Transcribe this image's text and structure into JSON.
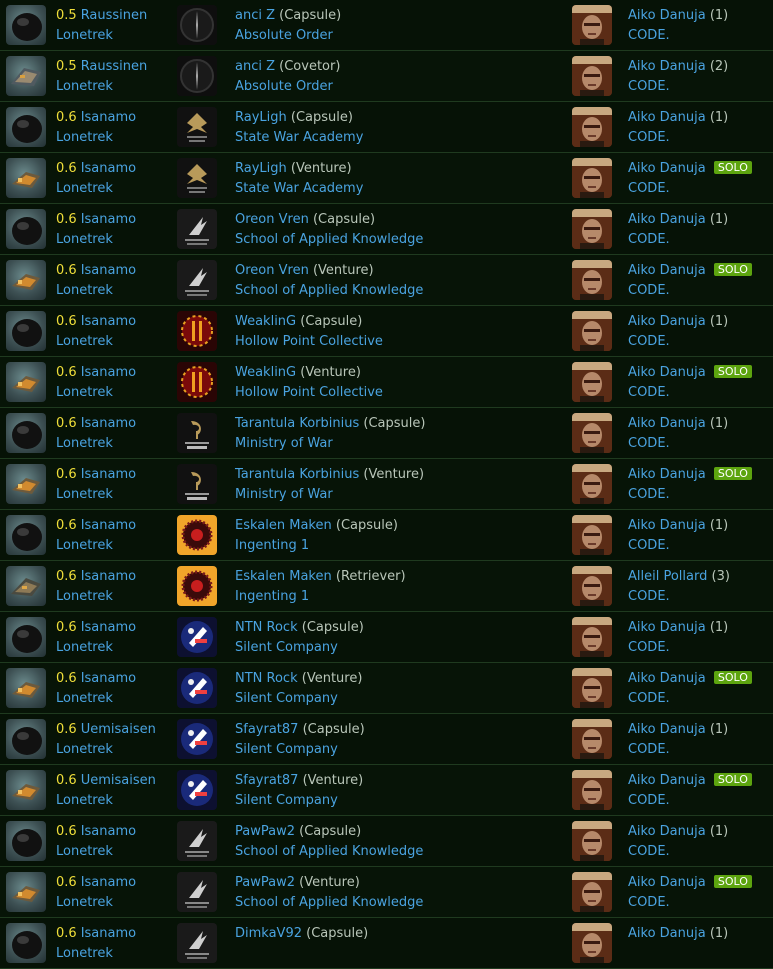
{
  "kills": [
    {
      "ship_icon": "capsule-icon",
      "sec": "0.5",
      "system": "Raussinen",
      "region": "Lonetrek",
      "corp_logo": "absolute-order-logo",
      "victim_name": "anci Z",
      "victim_ship": "(Capsule)",
      "victim_corp": "Absolute Order",
      "attacker": "Aiko Danuja",
      "count": "(1)",
      "solo": "",
      "attacker_corp": "CODE."
    },
    {
      "ship_icon": "covetor-icon",
      "sec": "0.5",
      "system": "Raussinen",
      "region": "Lonetrek",
      "corp_logo": "absolute-order-logo",
      "victim_name": "anci Z",
      "victim_ship": "(Covetor)",
      "victim_corp": "Absolute Order",
      "attacker": "Aiko Danuja",
      "count": "(2)",
      "solo": "",
      "attacker_corp": "CODE."
    },
    {
      "ship_icon": "capsule-icon",
      "sec": "0.6",
      "system": "Isanamo",
      "region": "Lonetrek",
      "corp_logo": "state-war-academy-logo",
      "victim_name": "RayLigh",
      "victim_ship": "(Capsule)",
      "victim_corp": "State War Academy",
      "attacker": "Aiko Danuja",
      "count": "(1)",
      "solo": "",
      "attacker_corp": "CODE."
    },
    {
      "ship_icon": "venture-icon",
      "sec": "0.6",
      "system": "Isanamo",
      "region": "Lonetrek",
      "corp_logo": "state-war-academy-logo",
      "victim_name": "RayLigh",
      "victim_ship": "(Venture)",
      "victim_corp": "State War Academy",
      "attacker": "Aiko Danuja",
      "count": "",
      "solo": "SOLO",
      "attacker_corp": "CODE."
    },
    {
      "ship_icon": "capsule-icon",
      "sec": "0.6",
      "system": "Isanamo",
      "region": "Lonetrek",
      "corp_logo": "school-of-applied-knowledge-logo",
      "victim_name": "Oreon Vren",
      "victim_ship": "(Capsule)",
      "victim_corp": "School of Applied Knowledge",
      "attacker": "Aiko Danuja",
      "count": "(1)",
      "solo": "",
      "attacker_corp": "CODE."
    },
    {
      "ship_icon": "venture-icon",
      "sec": "0.6",
      "system": "Isanamo",
      "region": "Lonetrek",
      "corp_logo": "school-of-applied-knowledge-logo",
      "victim_name": "Oreon Vren",
      "victim_ship": "(Venture)",
      "victim_corp": "School of Applied Knowledge",
      "attacker": "Aiko Danuja",
      "count": "",
      "solo": "SOLO",
      "attacker_corp": "CODE."
    },
    {
      "ship_icon": "capsule-icon",
      "sec": "0.6",
      "system": "Isanamo",
      "region": "Lonetrek",
      "corp_logo": "hollow-point-collective-logo",
      "victim_name": "WeaklinG",
      "victim_ship": "(Capsule)",
      "victim_corp": "Hollow Point Collective",
      "attacker": "Aiko Danuja",
      "count": "(1)",
      "solo": "",
      "attacker_corp": "CODE."
    },
    {
      "ship_icon": "venture-icon",
      "sec": "0.6",
      "system": "Isanamo",
      "region": "Lonetrek",
      "corp_logo": "hollow-point-collective-logo",
      "victim_name": "WeaklinG",
      "victim_ship": "(Venture)",
      "victim_corp": "Hollow Point Collective",
      "attacker": "Aiko Danuja",
      "count": "",
      "solo": "SOLO",
      "attacker_corp": "CODE."
    },
    {
      "ship_icon": "capsule-icon",
      "sec": "0.6",
      "system": "Isanamo",
      "region": "Lonetrek",
      "corp_logo": "ministry-of-war-logo",
      "victim_name": "Tarantula Korbinius",
      "victim_ship": "(Capsule)",
      "victim_corp": "Ministry of War",
      "attacker": "Aiko Danuja",
      "count": "(1)",
      "solo": "",
      "attacker_corp": "CODE."
    },
    {
      "ship_icon": "venture-icon",
      "sec": "0.6",
      "system": "Isanamo",
      "region": "Lonetrek",
      "corp_logo": "ministry-of-war-logo",
      "victim_name": "Tarantula Korbinius",
      "victim_ship": "(Venture)",
      "victim_corp": "Ministry of War",
      "attacker": "Aiko Danuja",
      "count": "",
      "solo": "SOLO",
      "attacker_corp": "CODE."
    },
    {
      "ship_icon": "capsule-icon",
      "sec": "0.6",
      "system": "Isanamo",
      "region": "Lonetrek",
      "corp_logo": "ingenting-1-logo",
      "victim_name": "Eskalen Maken",
      "victim_ship": "(Capsule)",
      "victim_corp": "Ingenting 1",
      "attacker": "Aiko Danuja",
      "count": "(1)",
      "solo": "",
      "attacker_corp": "CODE."
    },
    {
      "ship_icon": "retriever-icon",
      "sec": "0.6",
      "system": "Isanamo",
      "region": "Lonetrek",
      "corp_logo": "ingenting-1-logo",
      "victim_name": "Eskalen Maken",
      "victim_ship": "(Retriever)",
      "victim_corp": "Ingenting 1",
      "attacker": "Alleil Pollard",
      "count": "(3)",
      "solo": "",
      "attacker_corp": "CODE."
    },
    {
      "ship_icon": "capsule-icon",
      "sec": "0.6",
      "system": "Isanamo",
      "region": "Lonetrek",
      "corp_logo": "silent-company-logo",
      "victim_name": "NTN Rock",
      "victim_ship": "(Capsule)",
      "victim_corp": "Silent Company",
      "attacker": "Aiko Danuja",
      "count": "(1)",
      "solo": "",
      "attacker_corp": "CODE."
    },
    {
      "ship_icon": "venture-icon",
      "sec": "0.6",
      "system": "Isanamo",
      "region": "Lonetrek",
      "corp_logo": "silent-company-logo",
      "victim_name": "NTN Rock",
      "victim_ship": "(Venture)",
      "victim_corp": "Silent Company",
      "attacker": "Aiko Danuja",
      "count": "",
      "solo": "SOLO",
      "attacker_corp": "CODE."
    },
    {
      "ship_icon": "capsule-icon",
      "sec": "0.6",
      "system": "Uemisaisen",
      "region": "Lonetrek",
      "corp_logo": "silent-company-logo",
      "victim_name": "Sfayrat87",
      "victim_ship": "(Capsule)",
      "victim_corp": "Silent Company",
      "attacker": "Aiko Danuja",
      "count": "(1)",
      "solo": "",
      "attacker_corp": "CODE."
    },
    {
      "ship_icon": "venture-icon",
      "sec": "0.6",
      "system": "Uemisaisen",
      "region": "Lonetrek",
      "corp_logo": "silent-company-logo",
      "victim_name": "Sfayrat87",
      "victim_ship": "(Venture)",
      "victim_corp": "Silent Company",
      "attacker": "Aiko Danuja",
      "count": "",
      "solo": "SOLO",
      "attacker_corp": "CODE."
    },
    {
      "ship_icon": "capsule-icon",
      "sec": "0.6",
      "system": "Isanamo",
      "region": "Lonetrek",
      "corp_logo": "school-of-applied-knowledge-logo",
      "victim_name": "PawPaw2",
      "victim_ship": "(Capsule)",
      "victim_corp": "School of Applied Knowledge",
      "attacker": "Aiko Danuja",
      "count": "(1)",
      "solo": "",
      "attacker_corp": "CODE."
    },
    {
      "ship_icon": "venture-icon",
      "sec": "0.6",
      "system": "Isanamo",
      "region": "Lonetrek",
      "corp_logo": "school-of-applied-knowledge-logo",
      "victim_name": "PawPaw2",
      "victim_ship": "(Venture)",
      "victim_corp": "School of Applied Knowledge",
      "attacker": "Aiko Danuja",
      "count": "",
      "solo": "SOLO",
      "attacker_corp": "CODE."
    },
    {
      "ship_icon": "capsule-icon",
      "sec": "0.6",
      "system": "Isanamo",
      "region": "Lonetrek",
      "corp_logo": "school-of-applied-knowledge-logo",
      "victim_name": "DimkaV92",
      "victim_ship": "(Capsule)",
      "victim_corp": "",
      "attacker": "Aiko Danuja",
      "count": "(1)",
      "solo": "",
      "attacker_corp": ""
    }
  ]
}
